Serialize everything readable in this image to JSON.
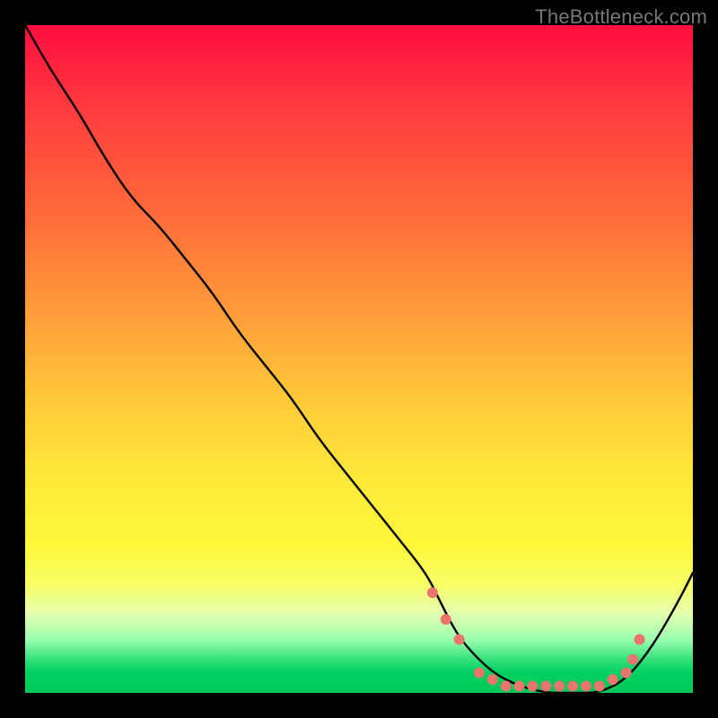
{
  "watermark": {
    "text": "TheBottleneck.com"
  },
  "chart_data": {
    "type": "line",
    "title": "",
    "xlabel": "",
    "ylabel": "",
    "xlim": [
      0,
      100
    ],
    "ylim": [
      0,
      100
    ],
    "grid": false,
    "legend": false,
    "background_gradient": {
      "top_color": "#ff0d3f",
      "mid_color": "#ffe93a",
      "bottom_color": "#00c858"
    },
    "series": [
      {
        "name": "bottleneck-curve",
        "color": "#000000",
        "x": [
          0,
          4,
          8,
          12,
          16,
          20,
          24,
          28,
          32,
          36,
          40,
          44,
          48,
          52,
          56,
          60,
          62,
          64,
          66,
          70,
          74,
          78,
          82,
          86,
          90,
          94,
          98,
          100
        ],
        "y": [
          100,
          93,
          87,
          80,
          74,
          70,
          65,
          60,
          54,
          49,
          44,
          38,
          33,
          28,
          23,
          18,
          14,
          10,
          7,
          3,
          1,
          0,
          0,
          0,
          2,
          7,
          14,
          18
        ]
      }
    ],
    "markers": {
      "name": "highlight-points",
      "color": "#e8766d",
      "radius_px": 6,
      "x": [
        61,
        63,
        65,
        68,
        70,
        72,
        74,
        76,
        78,
        80,
        82,
        84,
        86,
        88,
        90,
        91,
        92
      ],
      "y": [
        15,
        11,
        8,
        3,
        2,
        1,
        1,
        1,
        1,
        1,
        1,
        1,
        1,
        2,
        3,
        5,
        8
      ]
    }
  }
}
